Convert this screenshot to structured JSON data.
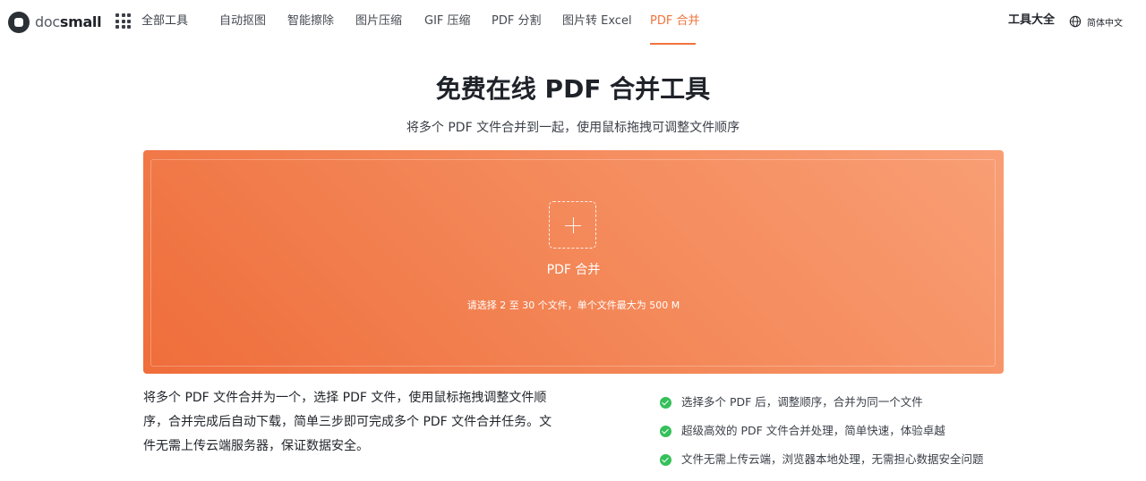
{
  "header": {
    "logo": {
      "part1": "doc",
      "part2": "small"
    },
    "all_tools": "全部工具",
    "nav": [
      {
        "label": "自动抠图",
        "active": false
      },
      {
        "label": "智能擦除",
        "active": false
      },
      {
        "label": "图片压缩",
        "active": false
      },
      {
        "label": "GIF 压缩",
        "active": false
      },
      {
        "label": "PDF 分割",
        "active": false
      },
      {
        "label": "图片转 Excel",
        "active": false
      },
      {
        "label": "PDF 合并",
        "active": true
      }
    ],
    "tools_all": "工具大全",
    "language": "简体中文",
    "accent_color": "#f0743e"
  },
  "main": {
    "title": "免费在线 PDF 合并工具",
    "subtitle": "将多个 PDF 文件合并到一起，使用鼠标拖拽可调整文件顺序",
    "upload": {
      "label": "PDF 合并",
      "hint": "请选择 2 至 30 个文件，单个文件最大为 500 M",
      "gradient_start": "#ef6d3b",
      "gradient_end": "#f99e75"
    },
    "description": "将多个 PDF 文件合并为一个，选择 PDF 文件，使用鼠标拖拽调整文件顺序，合并完成后自动下载，简单三步即可完成多个 PDF 文件合并任务。文件无需上传云端服务器，保证数据安全。",
    "features": [
      "选择多个 PDF 后，调整顺序，合并为同一个文件",
      "超级高效的 PDF 文件合并处理，简单快速，体验卓越",
      "文件无需上传云端，浏览器本地处理，无需担心数据安全问题"
    ],
    "check_color": "#34c05a"
  },
  "icons": {
    "logo": "docsmall-logo-icon",
    "apps": "grid-icon",
    "language": "globe-icon",
    "add": "plus-icon",
    "check": "check-circle-icon"
  }
}
